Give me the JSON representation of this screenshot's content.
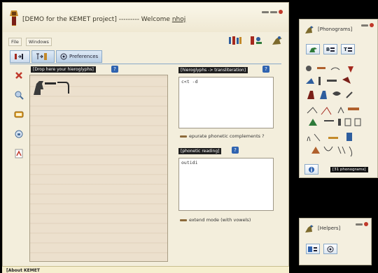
{
  "main_window": {
    "title": "[DEMO for the KEMET project] --------- Welcome ",
    "user": "nhoj"
  },
  "menu": {
    "file": "File",
    "windows": "Windows"
  },
  "tabs": [
    {
      "label": "",
      "icon": "hieroglyph-to-text-icon"
    },
    {
      "label": "",
      "icon": "text-to-hieroglyph-icon"
    },
    {
      "label": "Preferences",
      "icon": "preferences-icon"
    }
  ],
  "papyrus": {
    "label": "[Drop here your hieroglyphs]"
  },
  "transliteration": {
    "label": "[hieroglyphs -> transliteration]",
    "value": "c<t -d",
    "option": "epurate phonetic complements ?"
  },
  "phonetic": {
    "label": "[phonetic reading]",
    "value": "outidi",
    "option": "extend mode (with vowels)"
  },
  "about": {
    "label": "[About KEMET"
  },
  "phonograms_panel": {
    "title": "[Phonograms]",
    "count": "[31 phonograms]",
    "buttons": [
      "",
      "B",
      "T"
    ]
  },
  "helpers_panel": {
    "title": "[Helpers]"
  },
  "colors": {
    "title_bar": "#f0e9d3",
    "tab_blue": "#b9cfe6",
    "label_black": "#1f1f1f",
    "help_blue": "#2f63b0",
    "close_red": "#c0392b"
  }
}
